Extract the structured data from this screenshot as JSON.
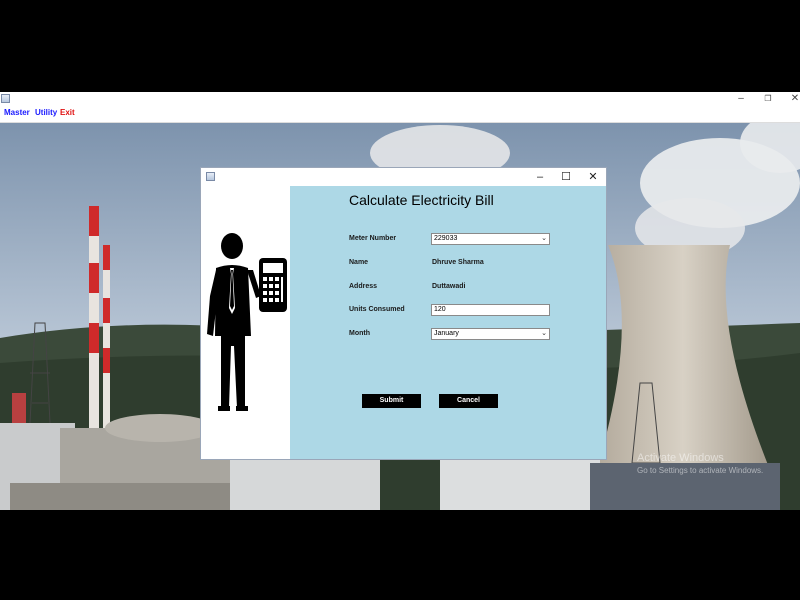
{
  "menu": {
    "master": "Master",
    "utility": "Utility",
    "exit": "Exit"
  },
  "window_controls": {
    "minimize": "–",
    "maximize": "❐",
    "close": "✕"
  },
  "dialog": {
    "title": "Calculate Electricity Bill",
    "controls": {
      "minimize": "–",
      "maximize": "☐",
      "close": "✕"
    },
    "fields": {
      "meter_number_label": "Meter Number",
      "meter_number_value": "229033",
      "name_label": "Name",
      "name_value": "Dhruve Sharma",
      "address_label": "Address",
      "address_value": "Duttawadi",
      "units_label": "Units Consumed",
      "units_value": "120",
      "month_label": "Month",
      "month_value": "January"
    },
    "buttons": {
      "submit": "Submit",
      "cancel": "Cancel"
    }
  },
  "watermark": {
    "line1": "Activate Windows",
    "line2": "Go to Settings to activate Windows."
  },
  "colors": {
    "menu_blue": "#1a1aff",
    "menu_red": "#e01010",
    "form_bg": "#add8e6"
  }
}
